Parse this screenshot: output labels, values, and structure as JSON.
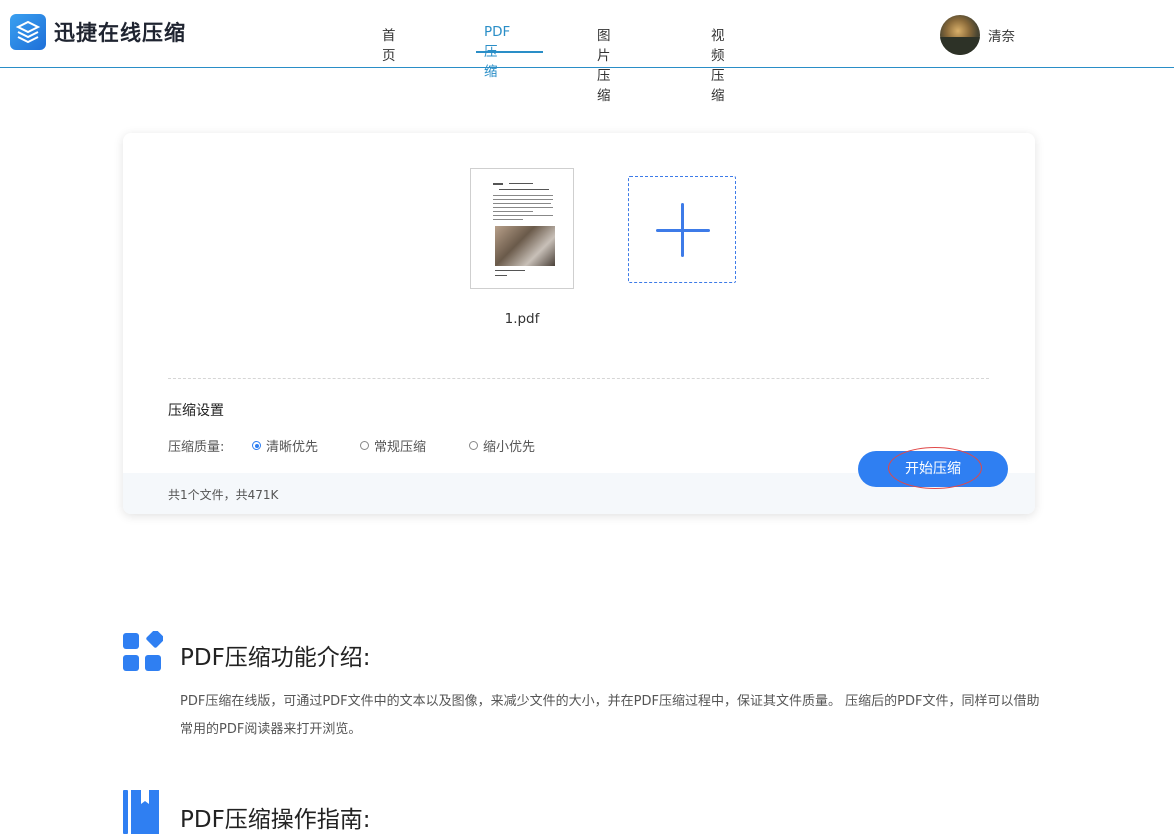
{
  "header": {
    "logo_text": "迅捷在线压缩",
    "nav": [
      {
        "label": "首页"
      },
      {
        "label": "PDF压缩"
      },
      {
        "label": "图片压缩"
      },
      {
        "label": "视频压缩"
      }
    ],
    "active_nav": "PDF压缩",
    "user_name": "清奈"
  },
  "upload": {
    "files": [
      {
        "name": "1.pdf"
      }
    ],
    "settings_title": "压缩设置",
    "quality_label": "压缩质量:",
    "options": [
      {
        "label": "清晰优先",
        "checked": true
      },
      {
        "label": "常规压缩",
        "checked": false
      },
      {
        "label": "缩小优先",
        "checked": false
      }
    ],
    "file_summary": "共1个文件，共471K",
    "start_button": "开始压缩"
  },
  "intro": {
    "title": "PDF压缩功能介绍:",
    "description": "PDF压缩在线版，可通过PDF文件中的文本以及图像，来减少文件的大小，并在PDF压缩过程中，保证其文件质量。 压缩后的PDF文件，同样可以借助常用的PDF阅读器来打开浏览。"
  },
  "guide": {
    "title": "PDF压缩操作指南:"
  },
  "colors": {
    "accent": "#2f7ff2",
    "nav_active": "#2a8ec7",
    "highlight_ring": "#e04848"
  }
}
